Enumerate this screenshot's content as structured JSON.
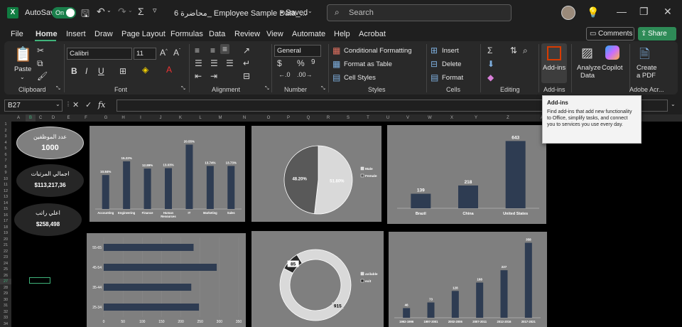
{
  "titlebar": {
    "app_icon": "X",
    "autosave_label": "AutoSave",
    "autosave_state": "On",
    "filename": "محاضرة 6_ Employee Sample Data_...",
    "saved_status": "• Saved",
    "search_placeholder": "Search"
  },
  "menu": [
    "File",
    "Home",
    "Insert",
    "Draw",
    "Page Layout",
    "Formulas",
    "Data",
    "Review",
    "View",
    "Automate",
    "Help",
    "Acrobat"
  ],
  "actions": {
    "comments": "Comments",
    "share": "Share"
  },
  "ribbon": {
    "clipboard": {
      "paste": "Paste",
      "group": "Clipboard"
    },
    "font": {
      "name": "Calibri",
      "size": "11",
      "group": "Font"
    },
    "alignment": {
      "group": "Alignment"
    },
    "number": {
      "format": "General",
      "group": "Number"
    },
    "styles": {
      "conditional": "Conditional Formatting",
      "format_table": "Format as Table",
      "cell_styles": "Cell Styles",
      "group": "Styles"
    },
    "cells": {
      "insert": "Insert",
      "delete": "Delete",
      "format": "Format",
      "group": "Cells"
    },
    "editing": {
      "group": "Editing"
    },
    "addins": {
      "button": "Add-ins",
      "group": "Add-ins"
    },
    "analyze": {
      "line1": "Analyze",
      "line2": "Data"
    },
    "copilot": "Copilot",
    "pdf": {
      "line1": "Create",
      "line2": "a PDF",
      "group": "Adobe Acr..."
    }
  },
  "tooltip": {
    "title": "Add-ins",
    "body": "Find add-ins that add new functionality to Office, simplify tasks, and connect you to services you use every day."
  },
  "formula": {
    "namebox": "B27",
    "fx": "fx"
  },
  "grid": {
    "columns": [
      "A",
      "B",
      "C",
      "D",
      "E",
      "F",
      "G",
      "H",
      "I",
      "J",
      "K",
      "L",
      "M",
      "N",
      "O",
      "P",
      "Q",
      "R",
      "S",
      "T",
      "U",
      "V",
      "W",
      "X",
      "Y",
      "Z",
      "AA"
    ],
    "rows": [
      "1",
      "2",
      "3",
      "4",
      "5",
      "6",
      "7",
      "8",
      "9",
      "10",
      "11",
      "12",
      "13",
      "14",
      "15",
      "16",
      "17",
      "18",
      "19",
      "20",
      "21",
      "22",
      "23",
      "24",
      "25",
      "26",
      "27",
      "28",
      "29",
      "30",
      "31",
      "32",
      "33",
      "34"
    ]
  },
  "kpis": [
    {
      "label": "عدد الموظفين",
      "value": "1000"
    },
    {
      "label": "اجمالي المرتبات",
      "value": "$113,217,36"
    },
    {
      "label": "اعلي راتب",
      "value": "$258,498"
    }
  ],
  "colors": {
    "bar": "#2e3c52",
    "panel": "#7f7f7f",
    "accent": "#107c41"
  },
  "chart_data": [
    {
      "type": "bar",
      "categories": [
        "Accounting",
        "Engineering",
        "Finance",
        "Human Resources",
        "IT",
        "Marketing",
        "Sales"
      ],
      "values": [
        10.84,
        15.22,
        12.89,
        13.03,
        20.55,
        13.74,
        13.73
      ],
      "data_labels": [
        "10.84%",
        "15.22%",
        "12.89%",
        "13.03%",
        "20.55%",
        "13.74%",
        "13.73%"
      ],
      "ylim": [
        0,
        22
      ]
    },
    {
      "type": "pie",
      "categories": [
        "Male",
        "Female"
      ],
      "values": [
        51.8,
        48.2
      ],
      "data_labels": [
        "51.80%",
        "48.20%"
      ],
      "colors": [
        "#d9d9d9",
        "#595959"
      ],
      "legend": "right"
    },
    {
      "type": "bar",
      "categories": [
        "Brazil",
        "China",
        "United States"
      ],
      "values": [
        139,
        218,
        643
      ],
      "data_labels": [
        "139",
        "218",
        "643"
      ],
      "ylim": [
        0,
        700
      ]
    },
    {
      "type": "bar",
      "orientation": "horizontal",
      "categories": [
        "55-65",
        "45-54",
        "35-44",
        "25-34"
      ],
      "values": [
        233,
        293,
        227,
        247
      ],
      "x_ticks": [
        "0",
        "50",
        "100",
        "150",
        "200",
        "250",
        "300",
        "350"
      ],
      "xlim": [
        0,
        350
      ]
    },
    {
      "type": "pie",
      "donut": true,
      "categories": [
        "avilable",
        "exit"
      ],
      "values": [
        915,
        85
      ],
      "data_labels": [
        "915",
        "85"
      ],
      "colors": [
        "#d9d9d9",
        "#262626"
      ],
      "legend": "right"
    },
    {
      "type": "bar",
      "categories": [
        "1992-1996",
        "1997-2001",
        "2002-2006",
        "2007-2011",
        "2012-2016",
        "2017-2021"
      ],
      "values": [
        46,
        73,
        128,
        168,
        227,
        358
      ],
      "data_labels": [
        "46",
        "73",
        "128",
        "168",
        "227",
        "358"
      ],
      "ylim": [
        0,
        370
      ]
    }
  ]
}
